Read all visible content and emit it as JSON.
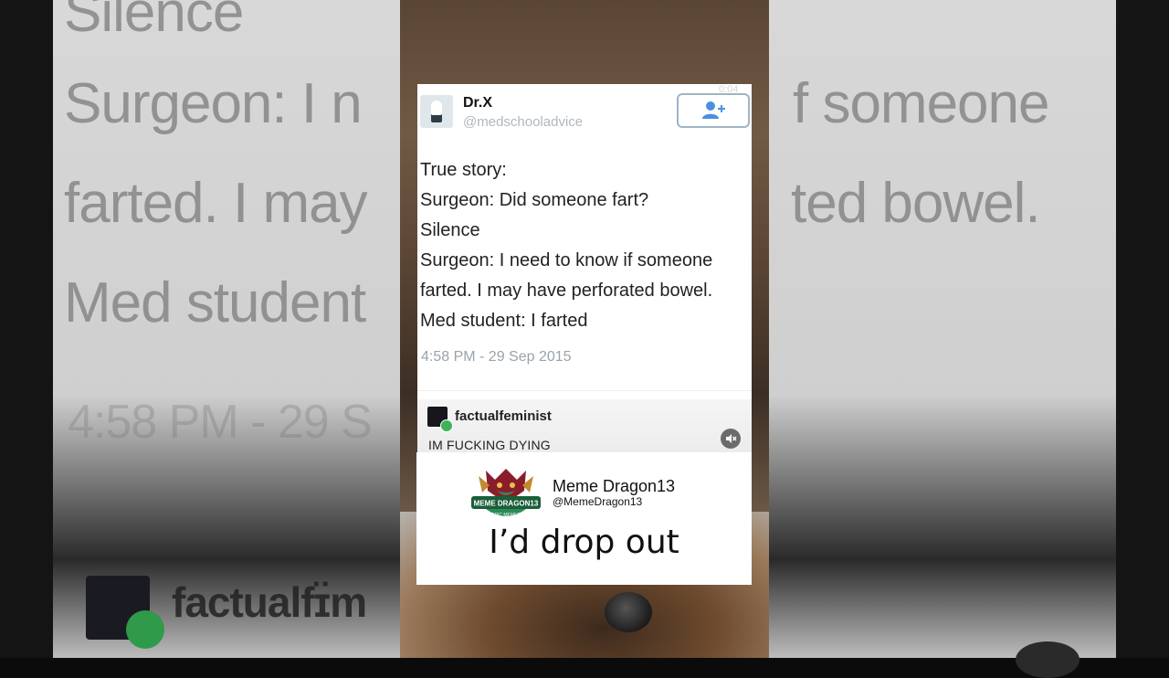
{
  "background_text": {
    "line1": "Silence",
    "line2a": "Surgeon: I n",
    "line2b": "f someone",
    "line3a": "farted. I may",
    "line3b": "ted bowel.",
    "line4a": "Med student",
    "time_fragment": "4:58 PM - 29 S",
    "reply_fragment": "factualfɪ̈m"
  },
  "video": {
    "timer": "0:04"
  },
  "tweet": {
    "display_name": "Dr.X",
    "handle": "@medschooladvice",
    "lines": [
      "True story:",
      "Surgeon: Did someone fart?",
      "Silence",
      "Surgeon: I need to know if someone",
      "farted. I may have perforated bowel.",
      "Med student: I farted"
    ],
    "timestamp": "4:58 PM - 29 Sep 2015"
  },
  "reply": {
    "name": "factualfeminist",
    "text": "IM FUCKING DYING"
  },
  "watermark": {
    "name": "Meme Dragon13",
    "handle": "@MemeDragon13",
    "logo_text": "MEME DRAGON13",
    "logo_subtext": "EPIC MEMES"
  },
  "caption": "I’d drop out",
  "colors": {
    "follow_icon": "#4a90e2",
    "badge_green": "#3fb15b",
    "logo_banner": "#1b5e3a"
  },
  "icons": [
    "follow-user-icon",
    "mute-icon",
    "dragon-logo"
  ]
}
